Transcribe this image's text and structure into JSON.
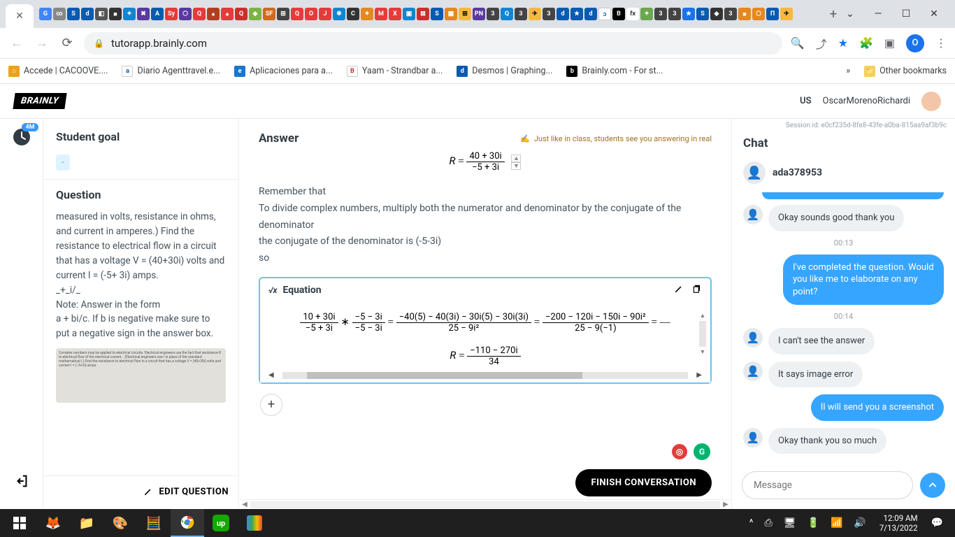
{
  "browser": {
    "url_host": "tutorapp.brainly.com",
    "bookmarks": [
      {
        "label": "Accede | CACOOVE....",
        "color": "#f0a020"
      },
      {
        "label": "Diario Agenttravel.e...",
        "color": "#0a5bb0",
        "glyph": "a"
      },
      {
        "label": "Aplicaciones para a...",
        "color": "#1976d2",
        "glyph": "e"
      },
      {
        "label": "Yaam - Strandbar a...",
        "color": "#fff",
        "glyph": "B"
      },
      {
        "label": "Desmos | Graphing...",
        "color": "#0a5bb0",
        "glyph": "d"
      },
      {
        "label": "Brainly.com - For st...",
        "color": "#000",
        "glyph": "b"
      }
    ],
    "other_bookmarks_label": "Other bookmarks",
    "avatar_letter": "O"
  },
  "header": {
    "logo_text": "BRAINLY",
    "region": "US",
    "username": "OscarMorenoRichardi"
  },
  "rail": {
    "badge_count": "4M"
  },
  "left": {
    "goal_title": "Student goal",
    "goal_value": "-",
    "question_title": "Question",
    "question_body_lines": [
      "measured in volts, resistance in ohms, and current in amperes.) Find the resistance to electrical flow in a circuit",
      "that has a voltage V = (40+30i) volts and current I = (-5+ 3i) amps.",
      "_+_i/_",
      "Note: Answer in the form",
      "a + bi/c. If b is negative make sure to put a negative sign in the answer box."
    ],
    "edit_label": "EDIT QUESTION"
  },
  "center": {
    "answer_title": "Answer",
    "hint_text": "Just like in class, students see you answering in real",
    "eq_R_top_num": "40 + 30i",
    "eq_R_top_den": "−5 + 3i",
    "explain_lines": [
      "Remember that",
      "To divide complex numbers, multiply both the numerator and denominator by the conjugate of the denominator",
      "the conjugate of the denominator is (-5-3i)",
      "so"
    ],
    "equation_label": "Equation",
    "long_eq_parts": {
      "f1_num": "10 + 30i",
      "f1_den": "−5 + 3i",
      "f2_num": "−5 − 3i",
      "f2_den": "−5 − 3i",
      "f3_num": "−40(5) − 40(3i) − 30i(5) − 30i(3i)",
      "f3_den": "25 − 9i²",
      "f4_num": "−200 − 120i − 150i − 90i²",
      "f4_den": "25 − 9(−1)",
      "r_num": "−110 − 270i",
      "r_den": "34"
    },
    "finish_label": "FINISH CONVERSATION"
  },
  "chat": {
    "session_id": "Session id: e0cf235d-8fe8-43fe-a0ba-815aa9af3b9c",
    "title": "Chat",
    "student_name": "ada378953",
    "messages": [
      {
        "side": "left",
        "text": "Okay sounds good thank you"
      },
      {
        "time": "00:13"
      },
      {
        "side": "right",
        "text": "I've completed the question. Would you like me to elaborate on any point?"
      },
      {
        "time": "00:14"
      },
      {
        "side": "left",
        "text": "I can't see the answer"
      },
      {
        "side": "left",
        "text": "It says image error"
      },
      {
        "side": "right",
        "text": "Il will send you a screenshot"
      },
      {
        "side": "left",
        "text": "Okay thank you so much"
      }
    ],
    "input_placeholder": "Message"
  },
  "taskbar": {
    "time": "12:09 AM",
    "date": "7/13/2022"
  }
}
